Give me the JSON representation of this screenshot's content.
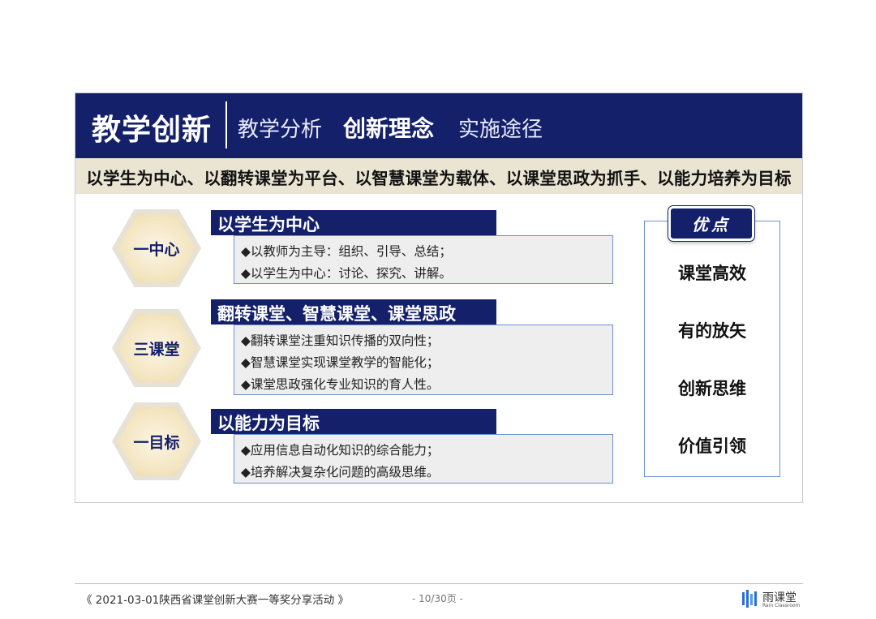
{
  "header": {
    "main_title": "教学创新",
    "tabs": [
      {
        "label": "教学分析"
      },
      {
        "label": "创新理念"
      },
      {
        "label": "实施途径"
      }
    ]
  },
  "subtitle": "以学生为中心、以翻转课堂为平台、以智慧课堂为载体、以课堂思政为抓手、以能力培养为目标",
  "sections": [
    {
      "hex_label": "一中心",
      "heading": "以学生为中心",
      "lines": [
        "◆以教师为主导：组织、引导、总结；",
        "◆以学生为中心：讨论、探究、讲解。"
      ]
    },
    {
      "hex_label": "三课堂",
      "heading": "翻转课堂、智慧课堂、课堂思政",
      "lines": [
        "◆翻转课堂注重知识传播的双向性；",
        "◆智慧课堂实现课堂教学的智能化；",
        "◆课堂思政强化专业知识的育人性。"
      ]
    },
    {
      "hex_label": "一目标",
      "heading": "以能力为目标",
      "lines": [
        "◆应用信息自动化知识的综合能力；",
        "◆培养解决复杂化问题的高级思维。"
      ]
    }
  ],
  "advantages": {
    "badge": "优点",
    "items": [
      "课堂高效",
      "有的放矢",
      "创新思维",
      "价值引领"
    ]
  },
  "footer": {
    "left": "《 2021-03-01陕西省课堂创新大赛一等奖分享活动 》",
    "page": "- 10/30页 -",
    "brand_name": "雨课堂",
    "brand_sub": "Rain Classroom",
    "brand_icon": "rain-classroom-logo"
  },
  "colors": {
    "navy": "#14206a",
    "subtitle_bg": "#eae4d2",
    "hex_fill": "#f3e5c0",
    "box_border": "#6f8fcf"
  }
}
